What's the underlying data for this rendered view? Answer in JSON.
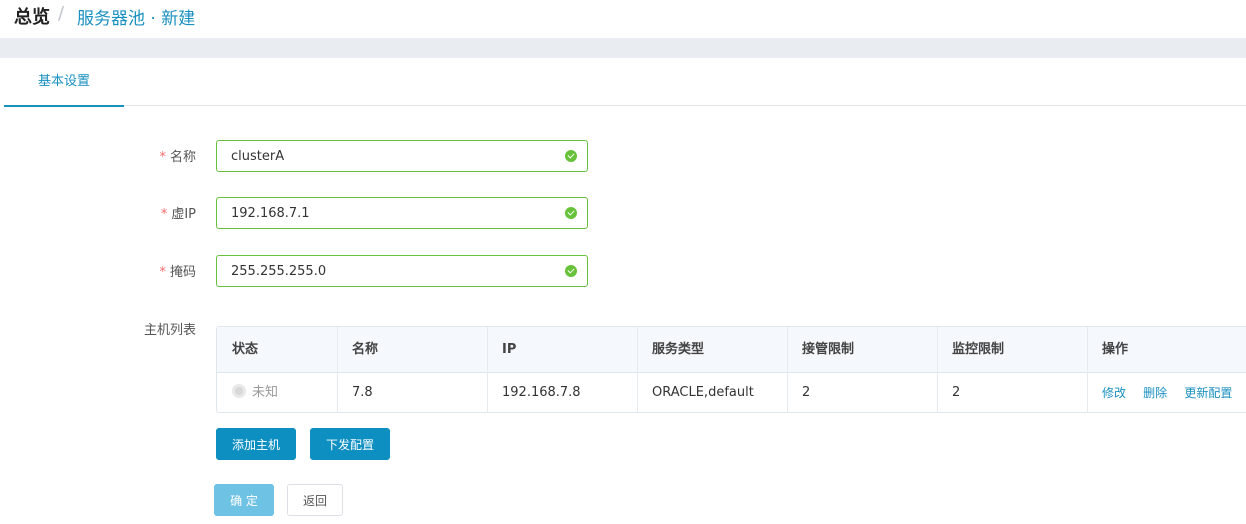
{
  "breadcrumb": {
    "root": "总览",
    "separator": "/",
    "current": "服务器池 · 新建"
  },
  "tabs": [
    {
      "label": "基本设置",
      "active": true
    }
  ],
  "form": {
    "required_mark": "*",
    "name": {
      "label": "名称",
      "value": "clusterA"
    },
    "vip": {
      "label": "虚IP",
      "value": "192.168.7.1"
    },
    "mask": {
      "label": "掩码",
      "value": "255.255.255.0"
    },
    "hosts_label": "主机列表"
  },
  "table": {
    "columns": [
      "状态",
      "名称",
      "IP",
      "服务类型",
      "接管限制",
      "监控限制",
      "操作"
    ],
    "rows": [
      {
        "status": "未知",
        "name": "7.8",
        "ip": "192.168.7.8",
        "service_type": "ORACLE,default",
        "takeover_limit": "2",
        "monitor_limit": "2",
        "actions": [
          "修改",
          "删除",
          "更新配置"
        ]
      }
    ]
  },
  "buttons": {
    "add_host": "添加主机",
    "push_config": "下发配置",
    "confirm": "确 定",
    "back": "返回"
  },
  "colors": {
    "accent": "#1a90c0",
    "valid": "#67c23a",
    "required": "#f56c6c",
    "primary_button": "#0e8fc2"
  }
}
